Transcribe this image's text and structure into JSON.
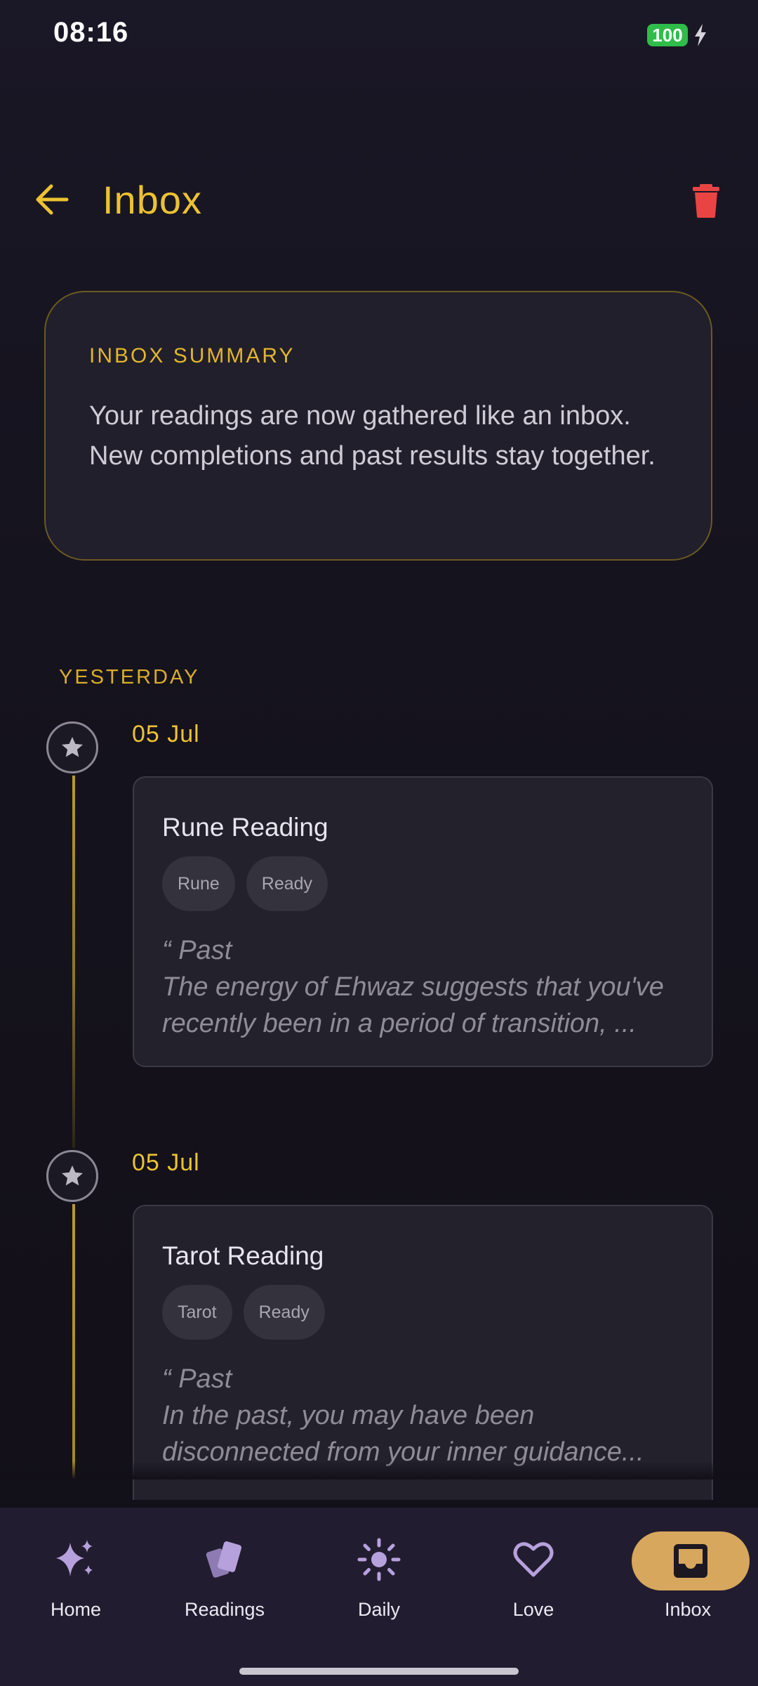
{
  "status_bar": {
    "time": "08:16",
    "battery": "100"
  },
  "header": {
    "title": "Inbox"
  },
  "summary": {
    "label": "INBOX SUMMARY",
    "text": "Your readings are now gathered like an inbox. New completions and past results stay together."
  },
  "section": {
    "label": "YESTERDAY"
  },
  "entries": [
    {
      "date": "05 Jul",
      "title": "Rune Reading",
      "tags": [
        "Rune",
        "Ready"
      ],
      "quote_heading": "“ Past",
      "quote_text": "The energy of Ehwaz suggests that you've recently been in a period of transition, ..."
    },
    {
      "date": "05 Jul",
      "title": "Tarot Reading",
      "tags": [
        "Tarot",
        "Ready"
      ],
      "quote_heading": "“ Past",
      "quote_text": "In the past, you may have been disconnected from your inner guidance..."
    }
  ],
  "nav": {
    "items": [
      {
        "label": "Home",
        "icon": "sparkles-icon"
      },
      {
        "label": "Readings",
        "icon": "cards-icon"
      },
      {
        "label": "Daily",
        "icon": "sun-icon"
      },
      {
        "label": "Love",
        "icon": "heart-icon"
      },
      {
        "label": "Inbox",
        "icon": "inbox-icon",
        "active": true
      }
    ]
  },
  "colors": {
    "accent": "#ecc232",
    "danger": "#e94444",
    "nav_active": "#d7a75d",
    "nav_icon": "#b7a1dc"
  }
}
